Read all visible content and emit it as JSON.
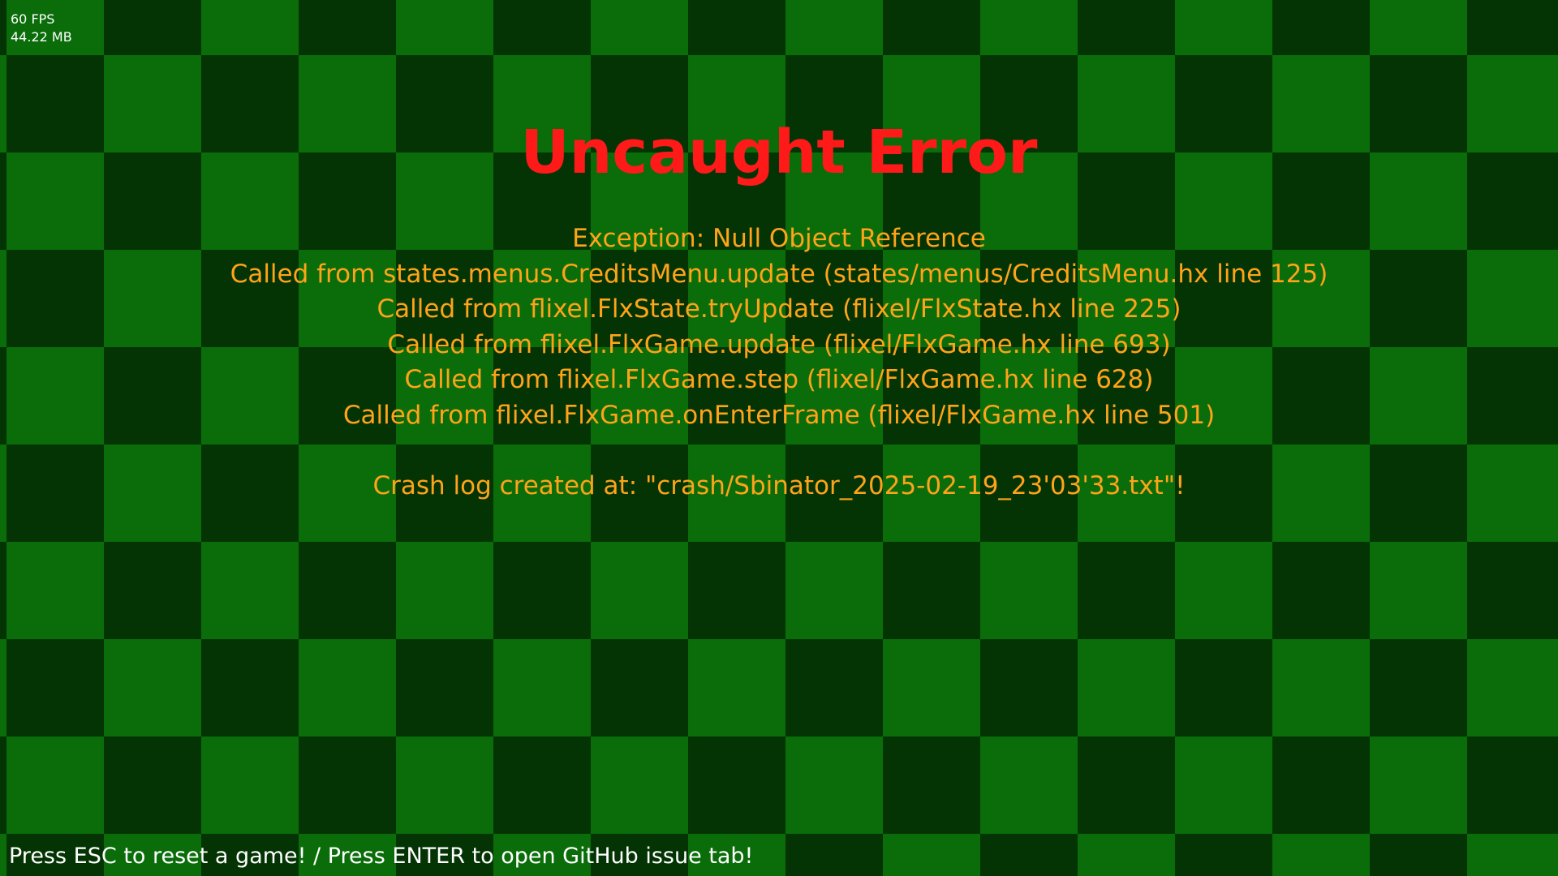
{
  "debug": {
    "fps": "60 FPS",
    "memory": "44.22 MB"
  },
  "error": {
    "title": "Uncaught Error",
    "lines": [
      "Exception: Null Object Reference",
      "Called from states.menus.CreditsMenu.update (states/menus/CreditsMenu.hx line 125)",
      "Called from flixel.FlxState.tryUpdate (flixel/FlxState.hx line 225)",
      "Called from flixel.FlxGame.update (flixel/FlxGame.hx line 693)",
      "Called from flixel.FlxGame.step (flixel/FlxGame.hx line 628)",
      "Called from flixel.FlxGame.onEnterFrame (flixel/FlxGame.hx line 501)",
      "",
      "Crash log created at: \"crash/Sbinator_2025-02-19_23'03'33.txt\"!"
    ]
  },
  "hint": "Press ESC to reset a game! / Press ENTER to open GitHub issue tab!",
  "colors": {
    "title": "#ff1a1a",
    "body": "#ffa319",
    "checker_light": "#0a6d0a",
    "checker_dark": "#043404"
  }
}
